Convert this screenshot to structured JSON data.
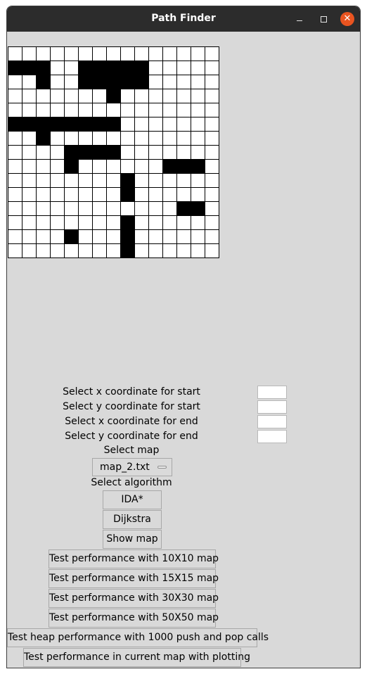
{
  "window": {
    "title": "Path Finder",
    "close_glyph": "✕"
  },
  "map": {
    "rows": 15,
    "cols": 15,
    "walls": [
      "...............",
      "###..#####.....",
      "..#..#####.....",
      ".......#.......",
      "...............",
      "########.......",
      "..#............",
      "....####.......",
      "....#......###.",
      "........#......",
      "........#......",
      "............##.",
      "........#......",
      "....#...#......",
      "........#......"
    ]
  },
  "form": {
    "start_x_label": "Select x coordinate for start",
    "start_y_label": "Select y coordinate for start",
    "end_x_label": "Select x coordinate for end",
    "end_y_label": "Select y coordinate for end",
    "start_x_value": "",
    "start_y_value": "",
    "end_x_value": "",
    "end_y_value": "",
    "map_label": "Select map",
    "map_value": "map_2.txt",
    "algorithm_label": "Select algorithm"
  },
  "buttons": {
    "ida_star": "IDA*",
    "dijkstra": "Dijkstra",
    "show_map": "Show map",
    "test_10": "Test performance with 10X10 map",
    "test_15": "Test performance with 15X15 map",
    "test_30": "Test performance with 30X30 map",
    "test_50": "Test performance with 50X50 map",
    "test_heap": "Test heap performance with 1000 push and pop calls",
    "test_current": "Test performance in current map with plotting"
  }
}
